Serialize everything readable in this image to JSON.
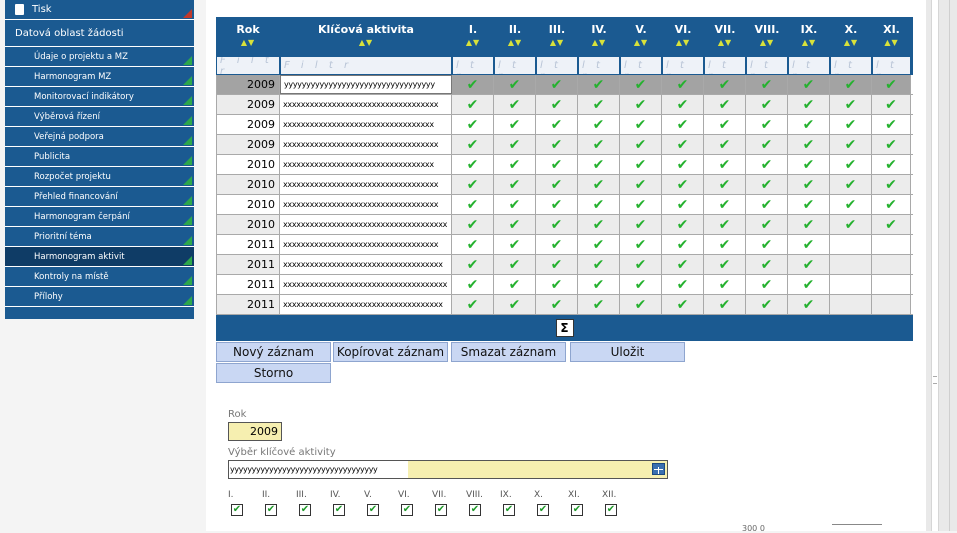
{
  "sidebar": {
    "print_label": "Tisk",
    "section_label": "Datová oblast žádosti",
    "items": [
      {
        "label": "Údaje o projektu a MZ"
      },
      {
        "label": "Harmonogram MZ"
      },
      {
        "label": "Monitorovací indikátory"
      },
      {
        "label": "Výběrová řízení"
      },
      {
        "label": "Veřejná podpora"
      },
      {
        "label": "Publicita"
      },
      {
        "label": "Rozpočet projektu"
      },
      {
        "label": "Přehled financování"
      },
      {
        "label": "Harmonogram čerpání"
      },
      {
        "label": "Prioritní téma"
      },
      {
        "label": "Harmonogram aktivit",
        "active": true
      },
      {
        "label": "Kontroly na místě"
      },
      {
        "label": "Přílohy"
      }
    ]
  },
  "table": {
    "columns": [
      "Rok",
      "Klíčová aktivita",
      "I.",
      "II.",
      "III.",
      "IV.",
      "V.",
      "VI.",
      "VII.",
      "VIII.",
      "IX.",
      "X.",
      "XI."
    ],
    "sort_arrows": "▲▼",
    "filter_placeholder": "F i l t r",
    "check_glyph": "✔",
    "rows": [
      {
        "year": "2009",
        "activity": "yyyyyyyyyyyyyyyyyyyyyyyyyyyyyyyyyy",
        "months": [
          1,
          1,
          1,
          1,
          1,
          1,
          1,
          1,
          1,
          1,
          1
        ],
        "selected": true
      },
      {
        "year": "2009",
        "activity": "xxxxxxxxxxxxxxxxxxxxxxxxxxxxxxxxxxx",
        "months": [
          1,
          1,
          1,
          1,
          1,
          1,
          1,
          1,
          1,
          1,
          1
        ]
      },
      {
        "year": "2009",
        "activity": "xxxxxxxxxxxxxxxxxxxxxxxxxxxxxxxxxx",
        "months": [
          1,
          1,
          1,
          1,
          1,
          1,
          1,
          1,
          1,
          1,
          1
        ]
      },
      {
        "year": "2009",
        "activity": "xxxxxxxxxxxxxxxxxxxxxxxxxxxxxxxxxxx",
        "months": [
          1,
          1,
          1,
          1,
          1,
          1,
          1,
          1,
          1,
          1,
          1
        ]
      },
      {
        "year": "2010",
        "activity": "xxxxxxxxxxxxxxxxxxxxxxxxxxxxxxxxxx",
        "months": [
          1,
          1,
          1,
          1,
          1,
          1,
          1,
          1,
          1,
          1,
          1
        ]
      },
      {
        "year": "2010",
        "activity": "xxxxxxxxxxxxxxxxxxxxxxxxxxxxxxxxxxx",
        "months": [
          1,
          1,
          1,
          1,
          1,
          1,
          1,
          1,
          1,
          1,
          1
        ]
      },
      {
        "year": "2010",
        "activity": "xxxxxxxxxxxxxxxxxxxxxxxxxxxxxxxxxxx",
        "months": [
          1,
          1,
          1,
          1,
          1,
          1,
          1,
          1,
          1,
          1,
          1
        ]
      },
      {
        "year": "2010",
        "activity": "xxxxxxxxxxxxxxxxxxxxxxxxxxxxxxxxxxxxx",
        "months": [
          1,
          1,
          1,
          1,
          1,
          1,
          1,
          1,
          1,
          1,
          1
        ]
      },
      {
        "year": "2011",
        "activity": "xxxxxxxxxxxxxxxxxxxxxxxxxxxxxxxxxxx",
        "months": [
          1,
          1,
          1,
          1,
          1,
          1,
          1,
          1,
          1,
          0,
          0
        ]
      },
      {
        "year": "2011",
        "activity": "xxxxxxxxxxxxxxxxxxxxxxxxxxxxxxxxxxxx",
        "months": [
          1,
          1,
          1,
          1,
          1,
          1,
          1,
          1,
          1,
          0,
          0
        ]
      },
      {
        "year": "2011",
        "activity": "xxxxxxxxxxxxxxxxxxxxxxxxxxxxxxxxxxxxx",
        "months": [
          1,
          1,
          1,
          1,
          1,
          1,
          1,
          1,
          1,
          0,
          0
        ]
      },
      {
        "year": "2011",
        "activity": "xxxxxxxxxxxxxxxxxxxxxxxxxxxxxxxxxxxx",
        "months": [
          1,
          1,
          1,
          1,
          1,
          1,
          1,
          1,
          1,
          0,
          0
        ]
      }
    ],
    "sum_glyph": "Σ"
  },
  "buttons": {
    "new": "Nový záznam",
    "copy": "Kopírovat záznam",
    "delete": "Smazat záznam",
    "save": "Uložit",
    "cancel": "Storno"
  },
  "form": {
    "year_label": "Rok",
    "year_value": "2009",
    "activity_label": "Výběr klíčové aktivity",
    "activity_value": "yyyyyyyyyyyyyyyyyyyyyyyyyyyyyyyyyy",
    "months": [
      "I.",
      "II.",
      "III.",
      "IV.",
      "V.",
      "VI.",
      "VII.",
      "VIII.",
      "IX.",
      "X.",
      "XI.",
      "XII."
    ],
    "month_checked_glyph": "✔"
  },
  "footer_text": "300 0"
}
